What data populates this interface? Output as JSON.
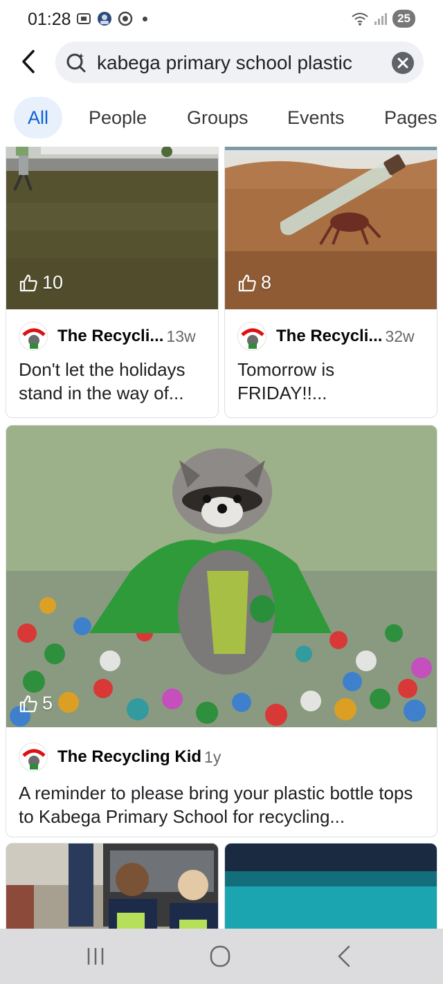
{
  "status_bar": {
    "time": "01:28",
    "battery": "25",
    "left_icons": [
      "screenshot-icon",
      "app-avatar-icon",
      "recording-icon"
    ],
    "right_icons": [
      "wifi-icon",
      "signal-icon"
    ]
  },
  "search": {
    "query": "kabega primary school plastic"
  },
  "tabs": [
    {
      "label": "All",
      "active": true
    },
    {
      "label": "People",
      "active": false
    },
    {
      "label": "Groups",
      "active": false
    },
    {
      "label": "Events",
      "active": false
    },
    {
      "label": "Pages",
      "active": false
    }
  ],
  "results": [
    {
      "author": "The Recycli...",
      "age": "13w",
      "likes": "10",
      "text": "Don't let the holidays stand in the way of...",
      "media": "photo-grass-field"
    },
    {
      "author": "The Recycli...",
      "age": "32w",
      "likes": "8",
      "text": "Tomorrow is FRIDAY!!...",
      "media": "photo-crab-bottle-beach"
    },
    {
      "author": "The Recycling Kid",
      "age": "1y",
      "likes": "5",
      "text": "A reminder to please bring your plastic bottle tops to Kabega Primary School for recycling...",
      "media": "photo-raccoon-bottle-caps"
    },
    {
      "media": "photo-school-children"
    },
    {
      "media": "photo-teal-fabric"
    }
  ],
  "colors": {
    "accent": "#0b61d8",
    "active_tab_bg": "#e7f0fb",
    "search_bg": "#eff1f4",
    "navbar_bg": "#dcdcde"
  },
  "navbar": {
    "buttons": [
      "recent-apps-icon",
      "home-icon",
      "back-icon"
    ]
  }
}
